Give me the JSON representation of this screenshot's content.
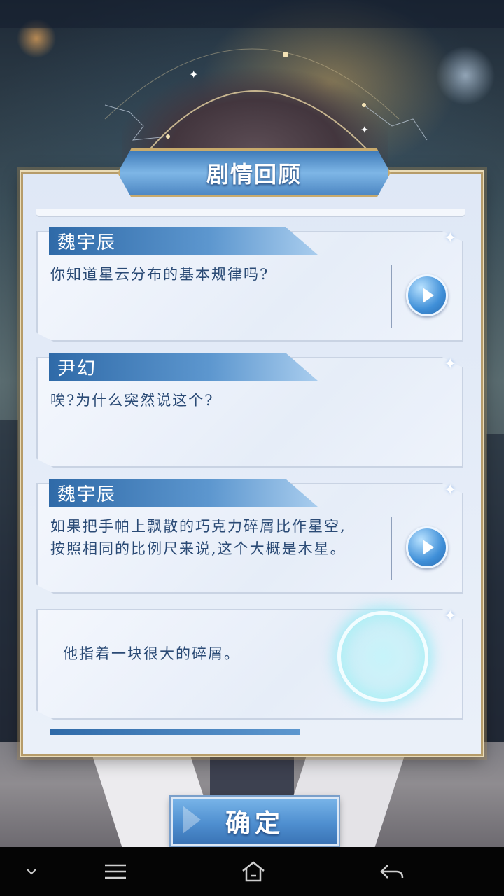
{
  "dialog": {
    "title": "剧情回顾",
    "confirm_label": "确定"
  },
  "entries": [
    {
      "speaker": "魏宇辰",
      "text": "你知道星云分布的基本规律吗?",
      "has_voice": true
    },
    {
      "speaker": "尹幻",
      "text": "唉?为什么突然说这个?",
      "has_voice": false
    },
    {
      "speaker": "魏宇辰",
      "text": "如果把手帕上飘散的巧克力碎屑比作星空,\n按照相同的比例尺来说,这个大概是木星。",
      "has_voice": true
    },
    {
      "speaker": "",
      "text": "他指着一块很大的碎屑。",
      "has_voice": false
    }
  ],
  "icons": {
    "voice": "play-icon",
    "nav_collapse": "chevron-down-icon",
    "nav_menu": "menu-icon",
    "nav_home": "home-icon",
    "nav_back": "back-icon"
  },
  "colors": {
    "accent_blue": "#4f8fd0",
    "frame_gold": "#b69c6a",
    "text_blue": "#2a4a75"
  }
}
